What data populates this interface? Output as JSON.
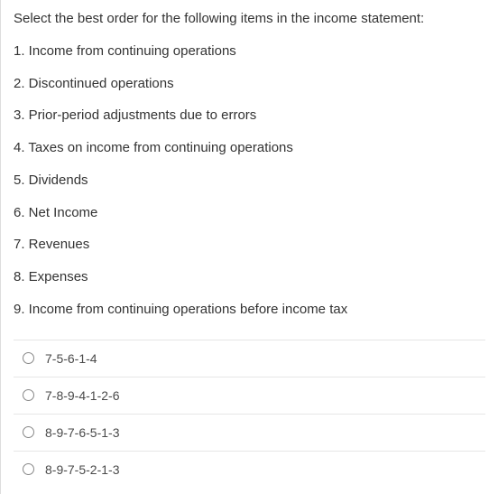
{
  "question": {
    "prompt": "Select the best order for the following items in the income statement:",
    "items": [
      "1. Income from continuing operations",
      "2. Discontinued operations",
      "3. Prior-period adjustments due to errors",
      "4. Taxes on income from continuing operations",
      "5. Dividends",
      "6. Net Income",
      "7. Revenues",
      "8. Expenses",
      "9. Income from continuing operations before income tax"
    ]
  },
  "choices": [
    "7-5-6-1-4",
    "7-8-9-4-1-2-6",
    "8-9-7-6-5-1-3",
    "8-9-7-5-2-1-3"
  ]
}
